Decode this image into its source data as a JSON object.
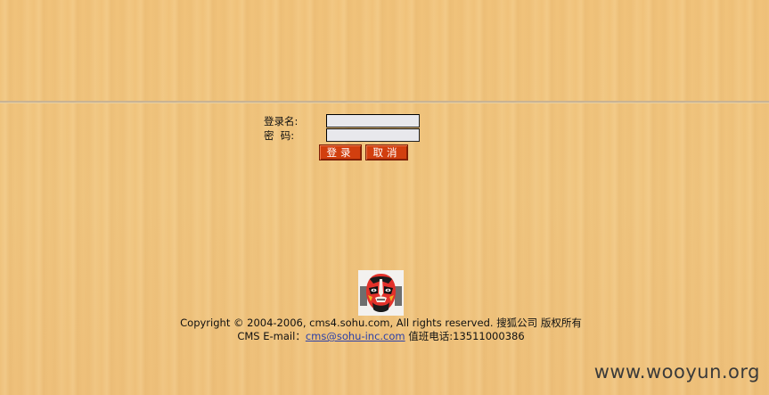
{
  "login": {
    "username_label": "登录名:",
    "password_label": "密  码:",
    "username_value": "",
    "password_value": "",
    "login_button": "登录",
    "cancel_button": "取消"
  },
  "footer": {
    "copyright": "Copyright © 2004-2006, cms4.sohu.com, All rights reserved. 搜狐公司 版权所有",
    "email_prefix": "CMS E-mail：",
    "email": "cms@sohu-inc.com",
    "phone": " 值班电话:13511000386"
  },
  "logo": {
    "icon": "opera-mask-icon"
  },
  "watermark": "www.wooyun.org",
  "colors": {
    "button_bg": "#d23f0f",
    "link": "#2a3fa8",
    "background": "#efc37c"
  }
}
